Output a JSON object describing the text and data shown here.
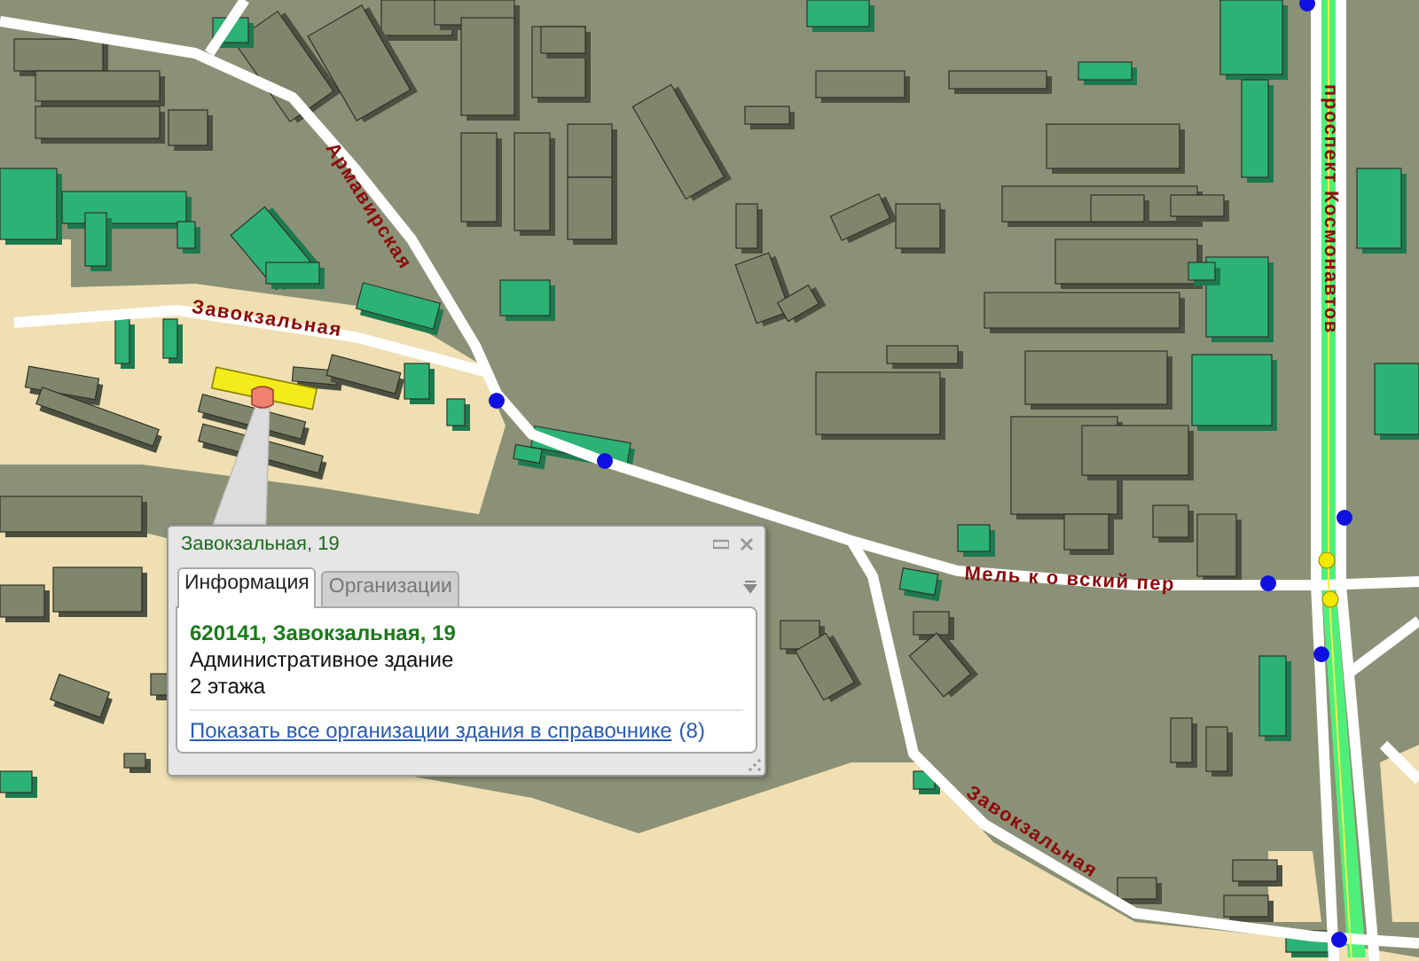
{
  "map": {
    "street_labels": [
      {
        "text": "Армавирская"
      },
      {
        "text": "Завокзальная"
      },
      {
        "text": "Мель к о вский пер"
      },
      {
        "text": "Завокзальная"
      },
      {
        "text": "проспект Космонавтов"
      }
    ]
  },
  "popup": {
    "title": "Завокзальная, 19",
    "tabs": [
      {
        "label": "Информация",
        "selected": true
      },
      {
        "label": "Организации",
        "selected": false
      }
    ],
    "address": "620141, Завокзальная, 19",
    "building_type": "Административное здание",
    "floors": "2 этажа",
    "link": "Показать все организации здания в справочнике",
    "count": "(8)"
  }
}
